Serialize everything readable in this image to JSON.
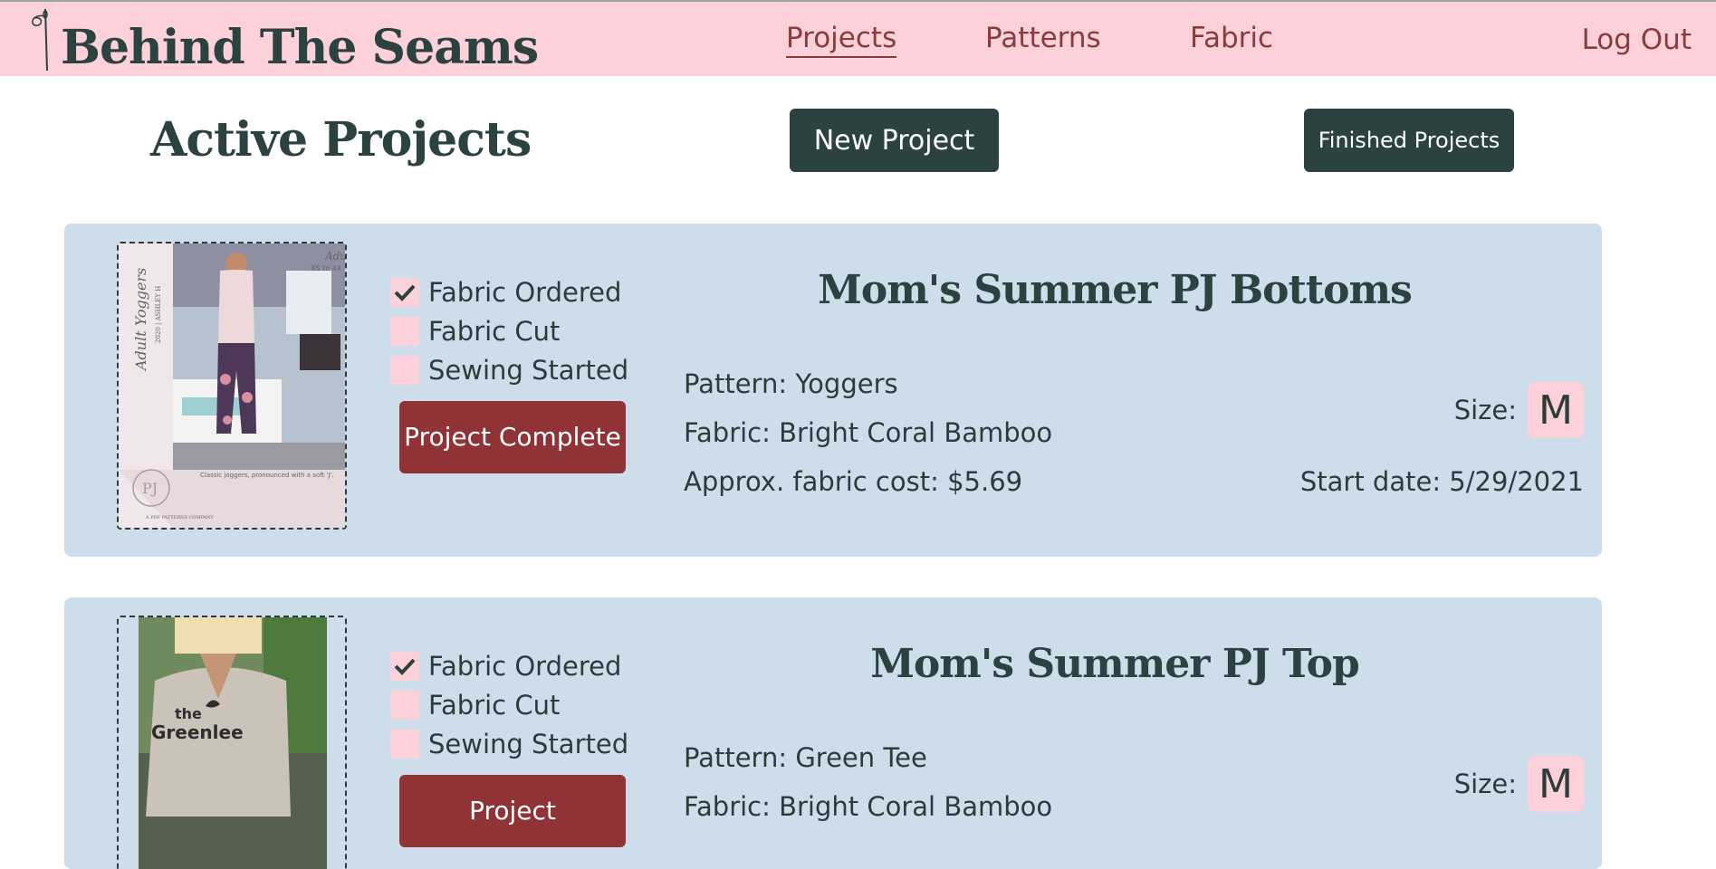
{
  "header": {
    "logo": "Behind The Seams",
    "nav": [
      "Projects",
      "Patterns",
      "Fabric"
    ],
    "logout": "Log Out"
  },
  "page": {
    "title": "Active Projects",
    "new_project": "New Project",
    "finished_projects": "Finished Projects"
  },
  "projects": [
    {
      "title": "Mom's Summer PJ Bottoms",
      "checklist": [
        {
          "label": "Fabric Ordered",
          "checked": true
        },
        {
          "label": "Fabric Cut",
          "checked": false
        },
        {
          "label": "Sewing Started",
          "checked": false
        }
      ],
      "complete_button": "Project Complete",
      "pattern": "Pattern: Yoggers",
      "fabric": "Fabric: Bright Coral Bamboo",
      "cost": "Approx. fabric cost: $5.69",
      "size_label": "Size:",
      "size": "M",
      "start_date": "Start date: 5/29/2021",
      "image_text": {
        "side": "Adult Yoggers",
        "year": "2020 | ASHLEY H",
        "corner": "Adult",
        "range": "XS to 4X",
        "caption": "Classic joggers, pronounced with a soft 'J'.",
        "monogram": "PJ",
        "brand": "A PDF PATTERNS COMPANY"
      }
    },
    {
      "title": "Mom's Summer PJ Top",
      "checklist": [
        {
          "label": "Fabric Ordered",
          "checked": true
        },
        {
          "label": "Fabric Cut",
          "checked": false
        },
        {
          "label": "Sewing Started",
          "checked": false
        }
      ],
      "complete_button": "Project",
      "pattern": "Pattern: Green Tee",
      "fabric": "Fabric: Bright Coral Bamboo",
      "size_label": "Size:",
      "size": "M",
      "image_text": {
        "shirt_line1": "the",
        "shirt_line2": "Greenlee"
      }
    }
  ],
  "colors": {
    "header_bg": "#fdd1da",
    "dark_green": "#2b4240",
    "accent_red": "#8f3337",
    "card_bg": "#cddde9"
  }
}
